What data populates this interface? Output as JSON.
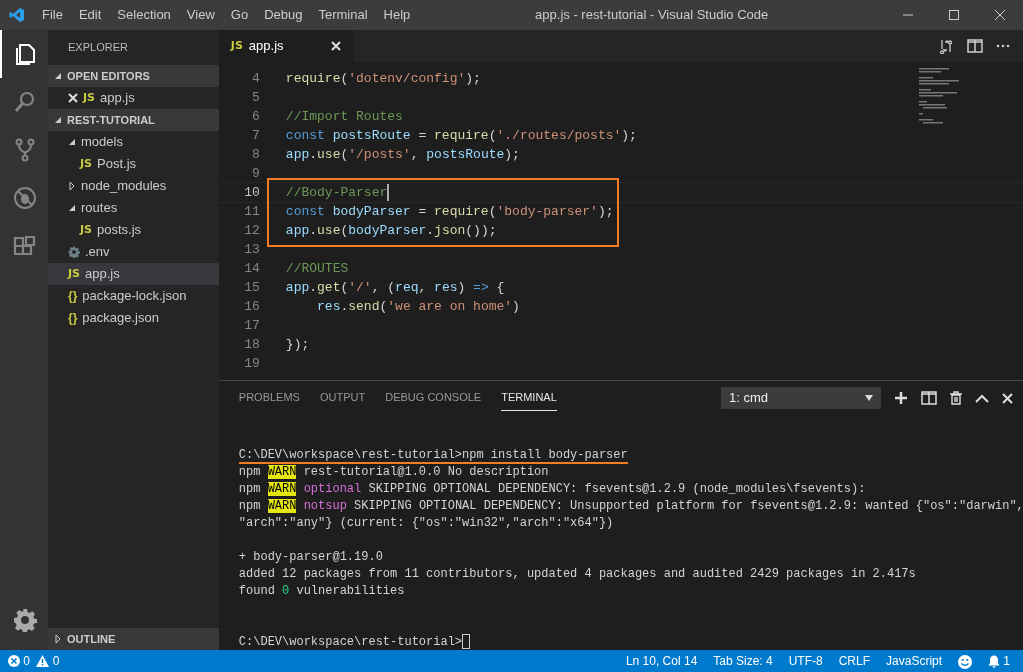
{
  "window": {
    "title": "app.js - rest-tutorial - Visual Studio Code"
  },
  "menu": [
    "File",
    "Edit",
    "Selection",
    "View",
    "Go",
    "Debug",
    "Terminal",
    "Help"
  ],
  "activity_bar": [
    {
      "kind": "files",
      "selected": true
    },
    {
      "kind": "search",
      "selected": false
    },
    {
      "kind": "scm",
      "selected": false
    },
    {
      "kind": "debug",
      "selected": false
    },
    {
      "kind": "extensions",
      "selected": false
    }
  ],
  "sidebar": {
    "title": "EXPLORER",
    "sections": [
      {
        "title": "OPEN EDITORS",
        "expanded": true,
        "items": [
          {
            "label": "app.js",
            "icon": "JS",
            "kind": "js",
            "closable": true,
            "selected": false
          }
        ]
      },
      {
        "title": "REST-TUTORIAL",
        "expanded": true,
        "items": [
          {
            "label": "models",
            "kind": "folder",
            "expanded": true,
            "selected": false,
            "children": [
              {
                "label": "Post.js",
                "icon": "JS",
                "kind": "js",
                "selected": false
              }
            ]
          },
          {
            "label": "node_modules",
            "kind": "folder",
            "expanded": false,
            "selected": false
          },
          {
            "label": "routes",
            "kind": "folder",
            "expanded": true,
            "selected": false,
            "children": [
              {
                "label": "posts.js",
                "icon": "JS",
                "kind": "js",
                "selected": false
              }
            ]
          },
          {
            "label": ".env",
            "kind": "config",
            "selected": false
          },
          {
            "label": "app.js",
            "icon": "JS",
            "kind": "js",
            "selected": true
          },
          {
            "label": "package-lock.json",
            "icon": "{}",
            "kind": "json",
            "selected": false
          },
          {
            "label": "package.json",
            "icon": "{}",
            "kind": "json",
            "selected": false
          }
        ]
      },
      {
        "title": "OUTLINE",
        "expanded": false
      }
    ]
  },
  "editor": {
    "tabs": [
      {
        "label": "app.js",
        "icon": "JS",
        "selected": true
      }
    ],
    "lines": [
      {
        "number": "4",
        "tokens": [
          {
            "t": "require",
            "kind": "func"
          },
          {
            "t": "(",
            "kind": "plain"
          },
          {
            "t": "'dotenv/config'",
            "kind": "string"
          },
          {
            "t": ");",
            "kind": "plain"
          }
        ]
      },
      {
        "number": "5"
      },
      {
        "number": "6",
        "tokens": [
          {
            "t": "//Import Routes",
            "kind": "comment"
          }
        ]
      },
      {
        "number": "7",
        "tokens": [
          {
            "t": "const ",
            "kind": "keyword"
          },
          {
            "t": "postsRoute",
            "kind": "var"
          },
          {
            "t": " = ",
            "kind": "plain"
          },
          {
            "t": "require",
            "kind": "func"
          },
          {
            "t": "(",
            "kind": "plain"
          },
          {
            "t": "'./routes/posts'",
            "kind": "string"
          },
          {
            "t": ");",
            "kind": "plain"
          }
        ]
      },
      {
        "number": "8",
        "tokens": [
          {
            "t": "app",
            "kind": "var"
          },
          {
            "t": ".",
            "kind": "plain"
          },
          {
            "t": "use",
            "kind": "func"
          },
          {
            "t": "(",
            "kind": "plain"
          },
          {
            "t": "'/posts'",
            "kind": "string"
          },
          {
            "t": ", ",
            "kind": "plain"
          },
          {
            "t": "postsRoute",
            "kind": "var"
          },
          {
            "t": ");",
            "kind": "plain"
          }
        ]
      },
      {
        "number": "9"
      },
      {
        "number": "10",
        "current": true,
        "boxed": true,
        "tokens": [
          {
            "t": "//Body-Parser",
            "kind": "comment"
          }
        ]
      },
      {
        "number": "11",
        "boxed": true,
        "tokens": [
          {
            "t": "const ",
            "kind": "keyword"
          },
          {
            "t": "bodyParser",
            "kind": "var"
          },
          {
            "t": " = ",
            "kind": "plain"
          },
          {
            "t": "require",
            "kind": "func"
          },
          {
            "t": "(",
            "kind": "plain"
          },
          {
            "t": "'body-parser'",
            "kind": "string"
          },
          {
            "t": ");",
            "kind": "plain"
          }
        ]
      },
      {
        "number": "12",
        "boxed": true,
        "tokens": [
          {
            "t": "app",
            "kind": "var"
          },
          {
            "t": ".",
            "kind": "plain"
          },
          {
            "t": "use",
            "kind": "func"
          },
          {
            "t": "(",
            "kind": "plain"
          },
          {
            "t": "bodyParser",
            "kind": "var"
          },
          {
            "t": ".",
            "kind": "plain"
          },
          {
            "t": "json",
            "kind": "func"
          },
          {
            "t": "());",
            "kind": "plain"
          }
        ]
      },
      {
        "number": "13"
      },
      {
        "number": "14",
        "tokens": [
          {
            "t": "//ROUTES",
            "kind": "comment"
          }
        ]
      },
      {
        "number": "15",
        "tokens": [
          {
            "t": "app",
            "kind": "var"
          },
          {
            "t": ".",
            "kind": "plain"
          },
          {
            "t": "get",
            "kind": "func"
          },
          {
            "t": "(",
            "kind": "plain"
          },
          {
            "t": "'/'",
            "kind": "string"
          },
          {
            "t": ", (",
            "kind": "plain"
          },
          {
            "t": "req",
            "kind": "var"
          },
          {
            "t": ", ",
            "kind": "plain"
          },
          {
            "t": "res",
            "kind": "var"
          },
          {
            "t": ") ",
            "kind": "plain"
          },
          {
            "t": "=>",
            "kind": "keyword"
          },
          {
            "t": " {",
            "kind": "plain"
          }
        ]
      },
      {
        "number": "16",
        "tokens": [
          {
            "t": "    res",
            "kind": "var"
          },
          {
            "t": ".",
            "kind": "plain"
          },
          {
            "t": "send",
            "kind": "func"
          },
          {
            "t": "(",
            "kind": "plain"
          },
          {
            "t": "'we are on home'",
            "kind": "string"
          },
          {
            "t": ")",
            "kind": "plain"
          }
        ]
      },
      {
        "number": "17"
      },
      {
        "number": "18",
        "tokens": [
          {
            "t": "});",
            "kind": "plain"
          }
        ]
      },
      {
        "number": "19"
      }
    ]
  },
  "panel": {
    "tabs": [
      {
        "label": "PROBLEMS",
        "selected": false
      },
      {
        "label": "OUTPUT",
        "selected": false
      },
      {
        "label": "DEBUG CONSOLE",
        "selected": false
      },
      {
        "label": "TERMINAL",
        "selected": true
      }
    ],
    "terminal_select": "1: cmd",
    "terminal": [
      {
        "kind": "blank"
      },
      {
        "underlined": true,
        "tokens": [
          {
            "t": "C:\\DEV\\workspace\\rest-tutorial>npm install body-parser",
            "kind": "plain"
          }
        ]
      },
      {
        "tokens": [
          {
            "t": "npm ",
            "kind": "plain"
          },
          {
            "t": "WARN",
            "kind": "warn"
          },
          {
            "t": " rest-tutorial@1.0.0 No description",
            "kind": "plain"
          }
        ]
      },
      {
        "tokens": [
          {
            "t": "npm ",
            "kind": "plain"
          },
          {
            "t": "WARN",
            "kind": "warn"
          },
          {
            "t": " optional",
            "kind": "magenta"
          },
          {
            "t": " SKIPPING OPTIONAL DEPENDENCY: fsevents@1.2.9 (node_modules\\fsevents):",
            "kind": "plain"
          }
        ]
      },
      {
        "tokens": [
          {
            "t": "npm ",
            "kind": "plain"
          },
          {
            "t": "WARN",
            "kind": "warn"
          },
          {
            "t": " notsup",
            "kind": "magenta"
          },
          {
            "t": " SKIPPING OPTIONAL DEPENDENCY: Unsupported platform for fsevents@1.2.9: wanted {\"os\":\"darwin\",",
            "kind": "plain"
          }
        ]
      },
      {
        "tokens": [
          {
            "t": "\"arch\":\"any\"} (current: {\"os\":\"win32\",\"arch\":\"x64\"})",
            "kind": "plain"
          }
        ]
      },
      {
        "kind": "blank"
      },
      {
        "tokens": [
          {
            "t": "+ body-parser@1.19.0",
            "kind": "plain"
          }
        ]
      },
      {
        "tokens": [
          {
            "t": "added 12 packages from 11 contributors, updated 4 packages and audited 2429 packages in 2.417s",
            "kind": "plain"
          }
        ]
      },
      {
        "tokens": [
          {
            "t": "found ",
            "kind": "plain"
          },
          {
            "t": "0",
            "kind": "green"
          },
          {
            "t": " vulnerabilities",
            "kind": "plain"
          }
        ]
      },
      {
        "kind": "blank"
      },
      {
        "kind": "blank"
      },
      {
        "cursor": true,
        "tokens": [
          {
            "t": "C:\\DEV\\workspace\\rest-tutorial>",
            "kind": "plain"
          }
        ]
      }
    ]
  },
  "status_bar": {
    "errors": "0",
    "warnings": "0",
    "items": [
      "Ln 10, Col 14",
      "Tab Size: 4",
      "UTF-8",
      "CRLF",
      "JavaScript"
    ],
    "notifications": "1"
  }
}
